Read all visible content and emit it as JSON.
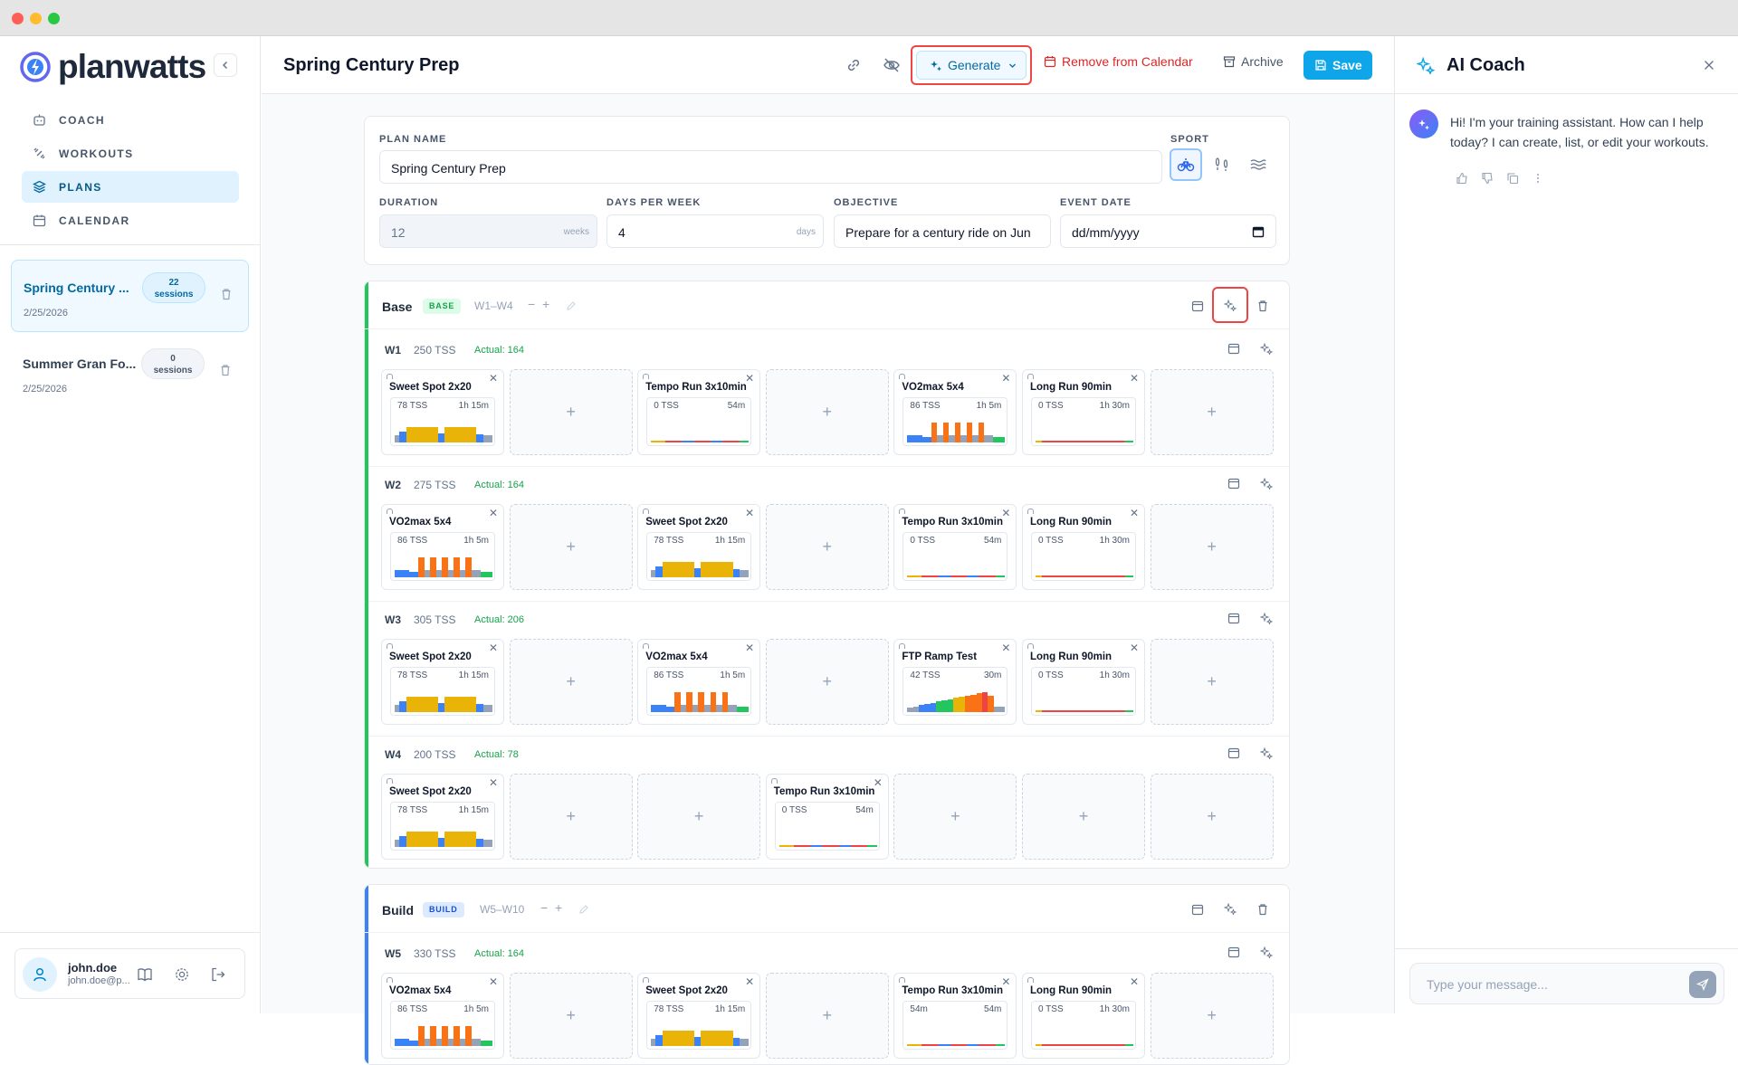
{
  "app": {
    "brand": "planwatts"
  },
  "sidebar": {
    "nav": [
      {
        "label": "COACH",
        "icon": "robot-icon"
      },
      {
        "label": "WORKOUTS",
        "icon": "dumbbell-icon"
      },
      {
        "label": "PLANS",
        "icon": "layers-icon",
        "active": true
      },
      {
        "label": "CALENDAR",
        "icon": "calendar-icon"
      }
    ],
    "plans": [
      {
        "title": "Spring Century ...",
        "badge_count": "22",
        "badge_unit": "sessions",
        "date": "2/25/2026",
        "active": true
      },
      {
        "title": "Summer Gran Fo...",
        "badge_count": "0",
        "badge_unit": "sessions",
        "date": "2/25/2026",
        "active": false
      }
    ],
    "user": {
      "name": "john.doe",
      "email": "john.doe@p..."
    }
  },
  "topbar": {
    "title": "Spring Century Prep",
    "generate_label": "Generate",
    "remove_label": "Remove from Calendar",
    "archive_label": "Archive",
    "save_label": "Save"
  },
  "form": {
    "plan_name_label": "PLAN NAME",
    "plan_name_value": "Spring Century Prep",
    "sport_label": "SPORT",
    "duration_label": "DURATION",
    "duration_value": "12",
    "duration_unit": "weeks",
    "days_label": "DAYS PER WEEK",
    "days_value": "4",
    "days_unit": "days",
    "objective_label": "OBJECTIVE",
    "objective_value": "Prepare for a century ride on Jun",
    "event_label": "EVENT DATE",
    "event_value": "dd/mm/yyyy"
  },
  "phases": [
    {
      "name": "Base",
      "tag": "BASE",
      "range": "W1–W4",
      "color": "#22c55e",
      "weeks": [
        {
          "label": "W1",
          "tss": "250 TSS",
          "actual": "Actual: 164",
          "slots": [
            {
              "name": "Sweet Spot 2x20",
              "tss": "78 TSS",
              "dur": "1h 15m",
              "profile": "sweetspot"
            },
            null,
            {
              "name": "Tempo Run 3x10min",
              "tss": "0 TSS",
              "dur": "54m",
              "profile": "tempo"
            },
            null,
            {
              "name": "VO2max 5x4",
              "tss": "86 TSS",
              "dur": "1h 5m",
              "profile": "vo2"
            },
            {
              "name": "Long Run 90min",
              "tss": "0 TSS",
              "dur": "1h 30m",
              "profile": "long"
            },
            null
          ]
        },
        {
          "label": "W2",
          "tss": "275 TSS",
          "actual": "Actual: 164",
          "slots": [
            {
              "name": "VO2max 5x4",
              "tss": "86 TSS",
              "dur": "1h 5m",
              "profile": "vo2"
            },
            null,
            {
              "name": "Sweet Spot 2x20",
              "tss": "78 TSS",
              "dur": "1h 15m",
              "profile": "sweetspot"
            },
            null,
            {
              "name": "Tempo Run 3x10min",
              "tss": "0 TSS",
              "dur": "54m",
              "profile": "tempo"
            },
            {
              "name": "Long Run 90min",
              "tss": "0 TSS",
              "dur": "1h 30m",
              "profile": "long"
            },
            null
          ]
        },
        {
          "label": "W3",
          "tss": "305 TSS",
          "actual": "Actual: 206",
          "slots": [
            {
              "name": "Sweet Spot 2x20",
              "tss": "78 TSS",
              "dur": "1h 15m",
              "profile": "sweetspot"
            },
            null,
            {
              "name": "VO2max 5x4",
              "tss": "86 TSS",
              "dur": "1h 5m",
              "profile": "vo2"
            },
            null,
            {
              "name": "FTP Ramp Test",
              "tss": "42 TSS",
              "dur": "30m",
              "profile": "ramp"
            },
            {
              "name": "Long Run 90min",
              "tss": "0 TSS",
              "dur": "1h 30m",
              "profile": "long"
            },
            null
          ]
        },
        {
          "label": "W4",
          "tss": "200 TSS",
          "actual": "Actual: 78",
          "slots": [
            {
              "name": "Sweet Spot 2x20",
              "tss": "78 TSS",
              "dur": "1h 15m",
              "profile": "sweetspot"
            },
            null,
            null,
            {
              "name": "Tempo Run 3x10min",
              "tss": "0 TSS",
              "dur": "54m",
              "profile": "tempo"
            },
            null,
            null,
            null
          ]
        }
      ]
    },
    {
      "name": "Build",
      "tag": "BUILD",
      "range": "W5–W10",
      "color": "#3b82f6",
      "weeks": [
        {
          "label": "W5",
          "tss": "330 TSS",
          "actual": "Actual: 164",
          "slots": [
            {
              "name": "VO2max 5x4",
              "tss": "86 TSS",
              "dur": "1h 5m",
              "profile": "vo2"
            },
            null,
            {
              "name": "Sweet Spot 2x20",
              "tss": "78 TSS",
              "dur": "1h 15m",
              "profile": "sweetspot"
            },
            null,
            {
              "name": "Tempo Run 3x10min",
              "tss": "54m",
              "dur": "54m",
              "profile": "tempo"
            },
            {
              "name": "Long Run 90min",
              "tss": "0 TSS",
              "dur": "1h 30m",
              "profile": "long"
            },
            null
          ]
        }
      ]
    }
  ],
  "coach": {
    "title": "AI Coach",
    "message": "Hi! I'm your training assistant. How can I help today? I can create, list, or edit your workouts.",
    "input_placeholder": "Type your message..."
  }
}
